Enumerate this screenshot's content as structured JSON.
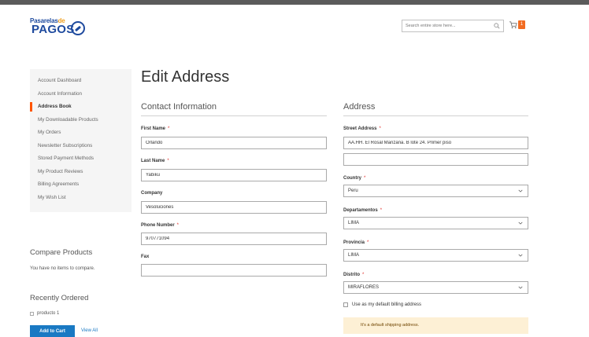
{
  "header": {
    "logo_line1": "Pasarelas",
    "logo_line1_accent": "de",
    "logo_line2": "PAGOS",
    "search_placeholder": "Search entire store here...",
    "cart_count": "1"
  },
  "account_nav": {
    "items": [
      {
        "label": "Account Dashboard",
        "active": false
      },
      {
        "label": "Account Information",
        "active": false
      },
      {
        "label": "Address Book",
        "active": true
      },
      {
        "label": "My Downloadable Products",
        "active": false
      },
      {
        "label": "My Orders",
        "active": false
      },
      {
        "label": "Newsletter Subscriptions",
        "active": false
      },
      {
        "label": "Stored Payment Methods",
        "active": false
      },
      {
        "label": "My Product Reviews",
        "active": false
      },
      {
        "label": "Billing Agreements",
        "active": false
      },
      {
        "label": "My Wish List",
        "active": false
      }
    ]
  },
  "compare": {
    "title": "Compare Products",
    "empty_text": "You have no items to compare."
  },
  "recent": {
    "title": "Recently Ordered",
    "item": "producto 1",
    "add_to_cart": "Add to Cart",
    "view_all": "View All"
  },
  "page": {
    "title": "Edit Address"
  },
  "contact": {
    "legend": "Contact Information",
    "first_name_label": "First Name",
    "first_name_value": "Orlando",
    "last_name_label": "Last Name",
    "last_name_value": "Yabiku",
    "company_label": "Company",
    "company_value": "Vesoluciones",
    "phone_label": "Phone Number",
    "phone_value": "970771094",
    "fax_label": "Fax",
    "fax_value": ""
  },
  "address": {
    "legend": "Address",
    "street_label": "Street Address",
    "street_value_1": "AA.HH. El Rosal Manzana. B lote 24. Primer piso",
    "street_value_2": "",
    "country_label": "Country",
    "country_value": "Peru",
    "departamentos_label": "Departamentos",
    "departamentos_value": "LIMA",
    "provincia_label": "Provincia",
    "provincia_value": "LIMA",
    "distrito_label": "Distrito",
    "distrito_value": "MIRAFLORES",
    "default_billing_label": "Use as my default billing address",
    "default_shipping_notice": "It's a default shipping address."
  },
  "required_mark": "*",
  "colors": {
    "accent": "#ff5501",
    "link": "#1979c3",
    "notice_bg": "#fdf0d5"
  }
}
